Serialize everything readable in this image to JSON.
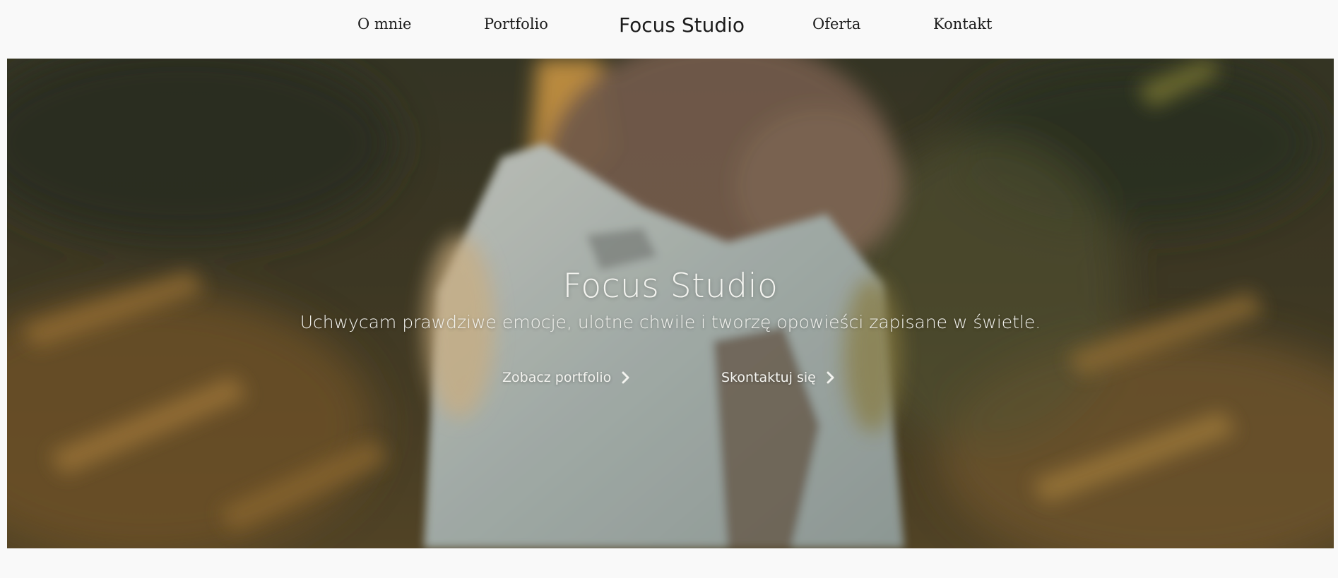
{
  "nav": {
    "left": [
      {
        "label": "O mnie"
      },
      {
        "label": "Portfolio"
      }
    ],
    "brand": "Focus Studio",
    "right": [
      {
        "label": "Oferta"
      },
      {
        "label": "Kontakt"
      }
    ]
  },
  "hero": {
    "title": "Focus Studio",
    "subtitle": "Uchwycam prawdziwe emocje, ulotne chwile i tworzę opowieści zapisane w świetle.",
    "buttons": [
      {
        "label": "Zobacz portfolio",
        "icon": "chevron-right-icon"
      },
      {
        "label": "Skontaktuj się",
        "icon": "chevron-right-icon"
      }
    ]
  },
  "colors": {
    "page_background": "#f9f9f9",
    "nav_text": "#1c1c1c",
    "hero_text": "#f4f4f0",
    "photo_grass_dark": "#3e3a26",
    "photo_warm_light": "#d9a046",
    "photo_sweater": "#b8c2bd"
  }
}
